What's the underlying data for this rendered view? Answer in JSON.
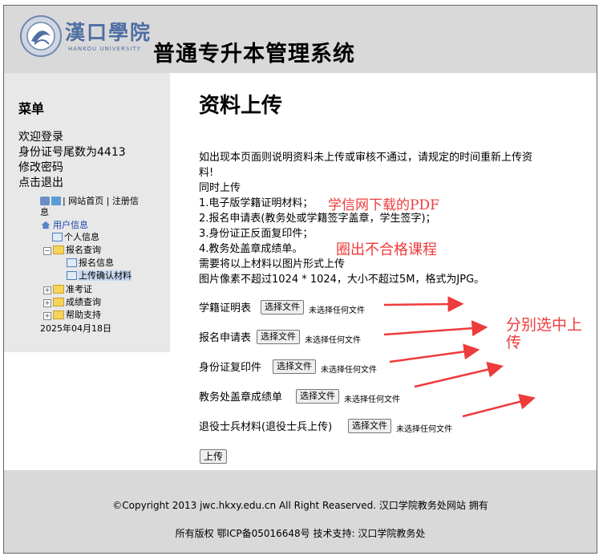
{
  "header": {
    "logo_text": "漢口學院",
    "logo_sub": "HANKOU UNIVERSITY",
    "system_title": "普通专升本管理系统"
  },
  "sidebar": {
    "menu_title": "菜单",
    "welcome": "欢迎登录",
    "id_tail": "身份证号尾数为4413",
    "change_password": "修改密码",
    "logout": "点击退出",
    "site_links": "| 网站首页 | 注册信息",
    "tree": {
      "user_info": "用户信息",
      "personal_info": "个人信息",
      "enroll_query": "报名查询",
      "enroll_info": "报名信息",
      "upload_confirm": "上传确认材料",
      "admission": "准考证",
      "score_query": "成绩查询",
      "help": "帮助支持"
    },
    "date": "2025年04月18日"
  },
  "main": {
    "title": "资料上传",
    "notice_1": "如出现本页面则说明资料未上传或审核不通过，请规定的时间重新上传资",
    "notice_2": "料!",
    "notice_3": "同时上传",
    "item_1": "1.电子版学籍证明材料；",
    "item_2": "2.报名申请表(教务处或学籍签字盖章，学生签字)；",
    "item_3": "3.身份证正反面复印件；",
    "item_4": "4.教务处盖章成绩单。",
    "notice_4": "需要将以上材料以图片形式上传",
    "notice_5": "图片像素不超过1024 * 1024，大小不超过5M，格式为JPG。",
    "uploads": [
      {
        "label": "学籍证明表",
        "button": "选择文件",
        "status": "未选择任何文件"
      },
      {
        "label": "报名申请表",
        "button": "选择文件",
        "status": "未选择任何文件"
      },
      {
        "label": "身份证复印件",
        "button": "选择文件",
        "status": "未选择任何文件"
      },
      {
        "label": "教务处盖章成绩单",
        "button": "选择文件",
        "status": "未选择任何文件"
      },
      {
        "label": "退役士兵材料(退役士兵上传)",
        "button": "选择文件",
        "status": "未选择任何文件"
      }
    ],
    "submit": "上传"
  },
  "annotations": {
    "pdf_note": "学信网下载的PDF",
    "circle_note": "圈出不合格课程",
    "separate_note_1": "分别选中上",
    "separate_note_2": "传",
    "color": "#ee3b3b"
  },
  "footer": {
    "line_1": "©Copyright 2013 jwc.hkxy.edu.cn All Right Reaserved. 汉口学院教务处网站 拥有",
    "line_2": "所有版权 鄂ICP备05016648号 技术支持: 汉口学院教务处"
  }
}
